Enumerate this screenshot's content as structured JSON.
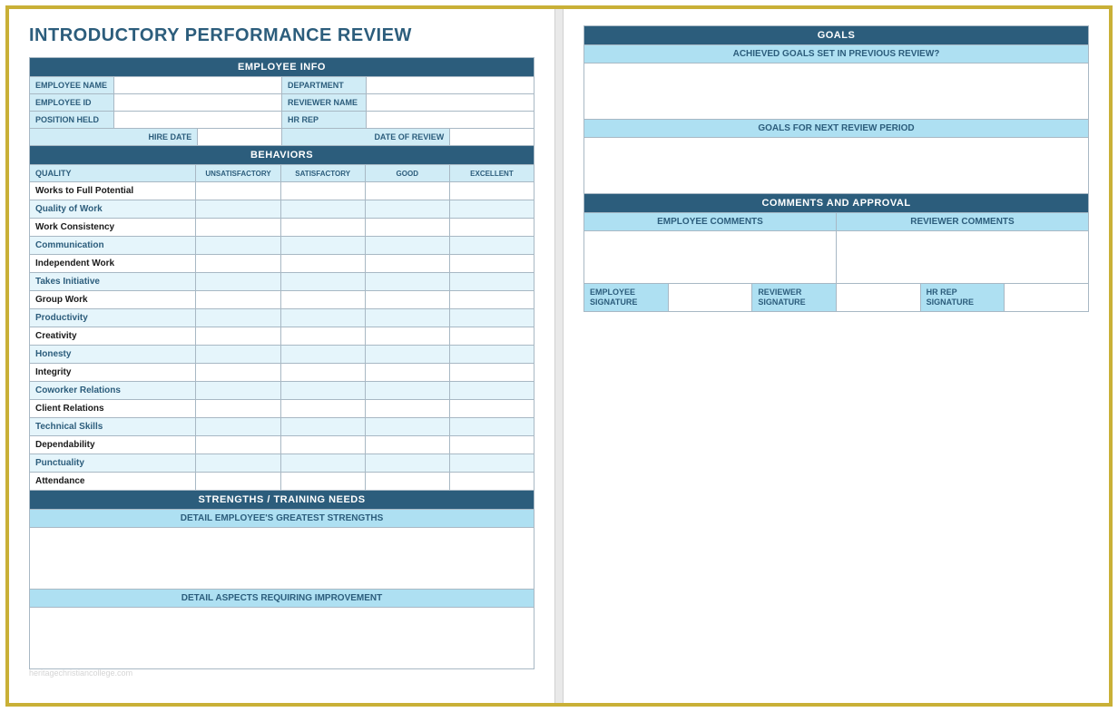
{
  "title": "INTRODUCTORY PERFORMANCE REVIEW",
  "employee_info": {
    "header": "EMPLOYEE INFO",
    "fields": {
      "employee_name": "EMPLOYEE NAME",
      "department": "DEPARTMENT",
      "employee_id": "EMPLOYEE ID",
      "reviewer_name": "REVIEWER NAME",
      "position_held": "POSITION HELD",
      "hr_rep": "HR REP",
      "hire_date": "HIRE DATE",
      "date_of_review": "DATE OF REVIEW"
    }
  },
  "behaviors": {
    "header": "BEHAVIORS",
    "quality_label": "QUALITY",
    "cols": [
      "UNSATISFACTORY",
      "SATISFACTORY",
      "GOOD",
      "EXCELLENT"
    ],
    "rows": [
      "Works to Full Potential",
      "Quality of Work",
      "Work Consistency",
      "Communication",
      "Independent Work",
      "Takes Initiative",
      "Group Work",
      "Productivity",
      "Creativity",
      "Honesty",
      "Integrity",
      "Coworker Relations",
      "Client Relations",
      "Technical Skills",
      "Dependability",
      "Punctuality",
      "Attendance"
    ]
  },
  "strengths": {
    "header": "STRENGTHS / TRAINING NEEDS",
    "strengths_label": "DETAIL EMPLOYEE'S GREATEST STRENGTHS",
    "improvement_label": "DETAIL ASPECTS REQUIRING IMPROVEMENT"
  },
  "goals": {
    "header": "GOALS",
    "achieved_label": "ACHIEVED GOALS SET IN PREVIOUS REVIEW?",
    "next_label": "GOALS FOR NEXT REVIEW PERIOD"
  },
  "comments": {
    "header": "COMMENTS AND APPROVAL",
    "employee_comments": "EMPLOYEE COMMENTS",
    "reviewer_comments": "REVIEWER COMMENTS",
    "sig": {
      "employee": "EMPLOYEE SIGNATURE",
      "reviewer": "REVIEWER SIGNATURE",
      "hr_rep": "HR REP SIGNATURE"
    }
  },
  "watermark": "heritagechristiancollege.com"
}
